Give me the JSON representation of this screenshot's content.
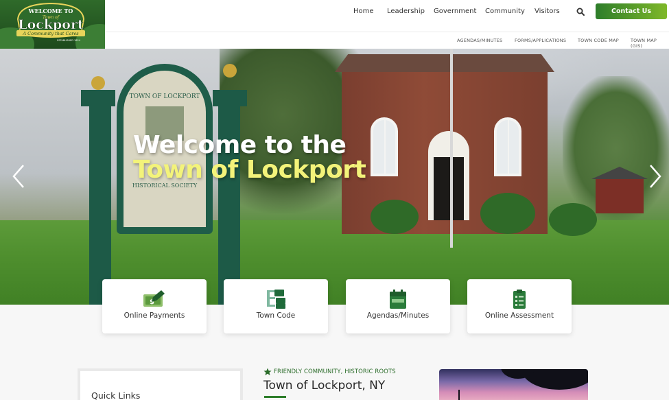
{
  "logo": {
    "line1": "WELCOME TO",
    "line2": "Town of",
    "line3": "Lockport",
    "tagline": "A Community that Cares",
    "established": "ESTABLISHED 1824"
  },
  "nav": {
    "items": [
      {
        "label": "Home"
      },
      {
        "label": "Leadership"
      },
      {
        "label": "Government"
      },
      {
        "label": "Community"
      },
      {
        "label": "Visitors"
      }
    ],
    "contact_label": "Contact Us"
  },
  "subnav": {
    "items": [
      {
        "label": "AGENDAS/MINUTES"
      },
      {
        "label": "FORMS/APPLICATIONS"
      },
      {
        "label": "TOWN CODE MAP"
      },
      {
        "label": "TOWN MAP (GIS)"
      }
    ]
  },
  "hero": {
    "title_line1": "Welcome to the",
    "title_line2": "Town of Lockport",
    "sign_text": "TOWN OF LOCKPORT",
    "sign_text_lower": "HISTORICAL SOCIETY"
  },
  "tiles": [
    {
      "label": "Online Payments",
      "icon": "payment-icon"
    },
    {
      "label": "Town Code",
      "icon": "sitemap-icon"
    },
    {
      "label": "Agendas/Minutes",
      "icon": "calendar-icon"
    },
    {
      "label": "Online Assessment",
      "icon": "clipboard-icon"
    }
  ],
  "content": {
    "quick_links_title": "Quick Links",
    "eyebrow": "FRIENDLY COMMUNITY, HISTORIC ROOTS",
    "title": "Town of Lockport, NY"
  },
  "colors": {
    "brand_green": "#2d7d2a",
    "accent_lime": "#7fb829",
    "hero_yellow": "#f3f37a"
  }
}
